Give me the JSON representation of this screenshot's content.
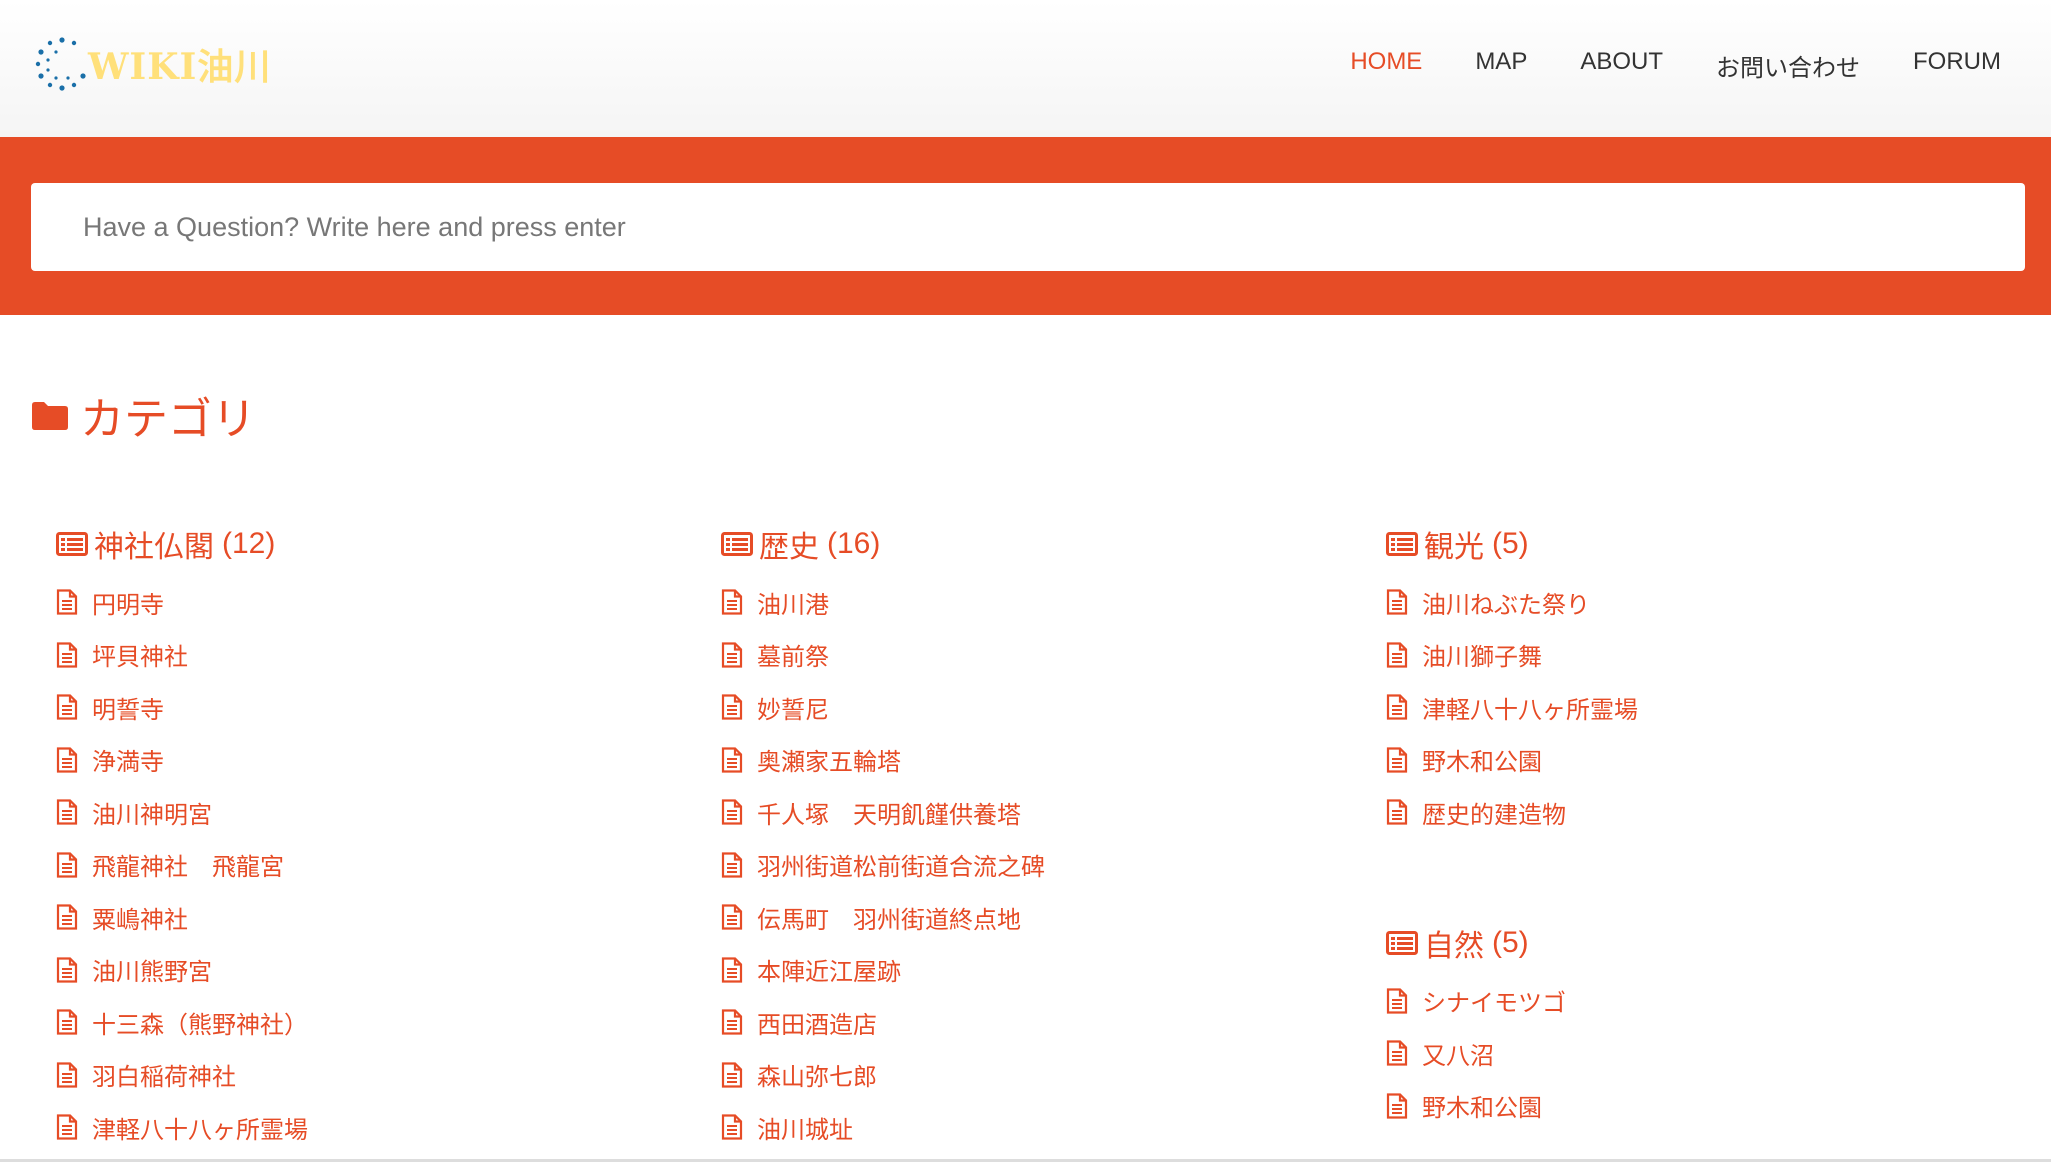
{
  "header": {
    "logo_text": "WIKI油川",
    "nav": [
      {
        "label": "HOME",
        "active": true
      },
      {
        "label": "MAP",
        "active": false
      },
      {
        "label": "ABOUT",
        "active": false
      },
      {
        "label": "お問い合わせ",
        "active": false
      },
      {
        "label": "FORUM",
        "active": false
      }
    ]
  },
  "search": {
    "placeholder": "Have a Question? Write here and press enter"
  },
  "categories": {
    "title": "カテゴリ",
    "columns": [
      [
        {
          "name": "神社仏閣",
          "count": "(12)",
          "items": [
            "円明寺",
            "坪貝神社",
            "明誓寺",
            "浄満寺",
            "油川神明宮",
            "飛龍神社　飛龍宮",
            "粟嶋神社",
            "油川熊野宮",
            "十三森（熊野神社）",
            "羽白稲荷神社",
            "津軽八十八ヶ所霊場"
          ]
        }
      ],
      [
        {
          "name": "歴史",
          "count": "(16)",
          "items": [
            "油川港",
            "墓前祭",
            "妙誓尼",
            "奥瀬家五輪塔",
            "千人塚　天明飢饉供養塔",
            "羽州街道松前街道合流之碑",
            "伝馬町　羽州街道終点地",
            "本陣近江屋跡",
            "西田酒造店",
            "森山弥七郎",
            "油川城址"
          ]
        }
      ],
      [
        {
          "name": "観光",
          "count": "(5)",
          "items": [
            "油川ねぶた祭り",
            "油川獅子舞",
            "津軽八十八ヶ所霊場",
            "野木和公園",
            "歴史的建造物"
          ]
        },
        {
          "name": "自然",
          "count": "(5)",
          "items": [
            "シナイモツゴ",
            "又八沼",
            "野木和公園"
          ]
        }
      ]
    ]
  },
  "colors": {
    "accent": "#e64c26",
    "nav_text": "#333333",
    "logo_text": "#ffe07a",
    "logo_dots": "#1a6fa8"
  },
  "icons": {
    "folder": "folder-icon",
    "category": "list-icon",
    "item": "document-icon"
  }
}
